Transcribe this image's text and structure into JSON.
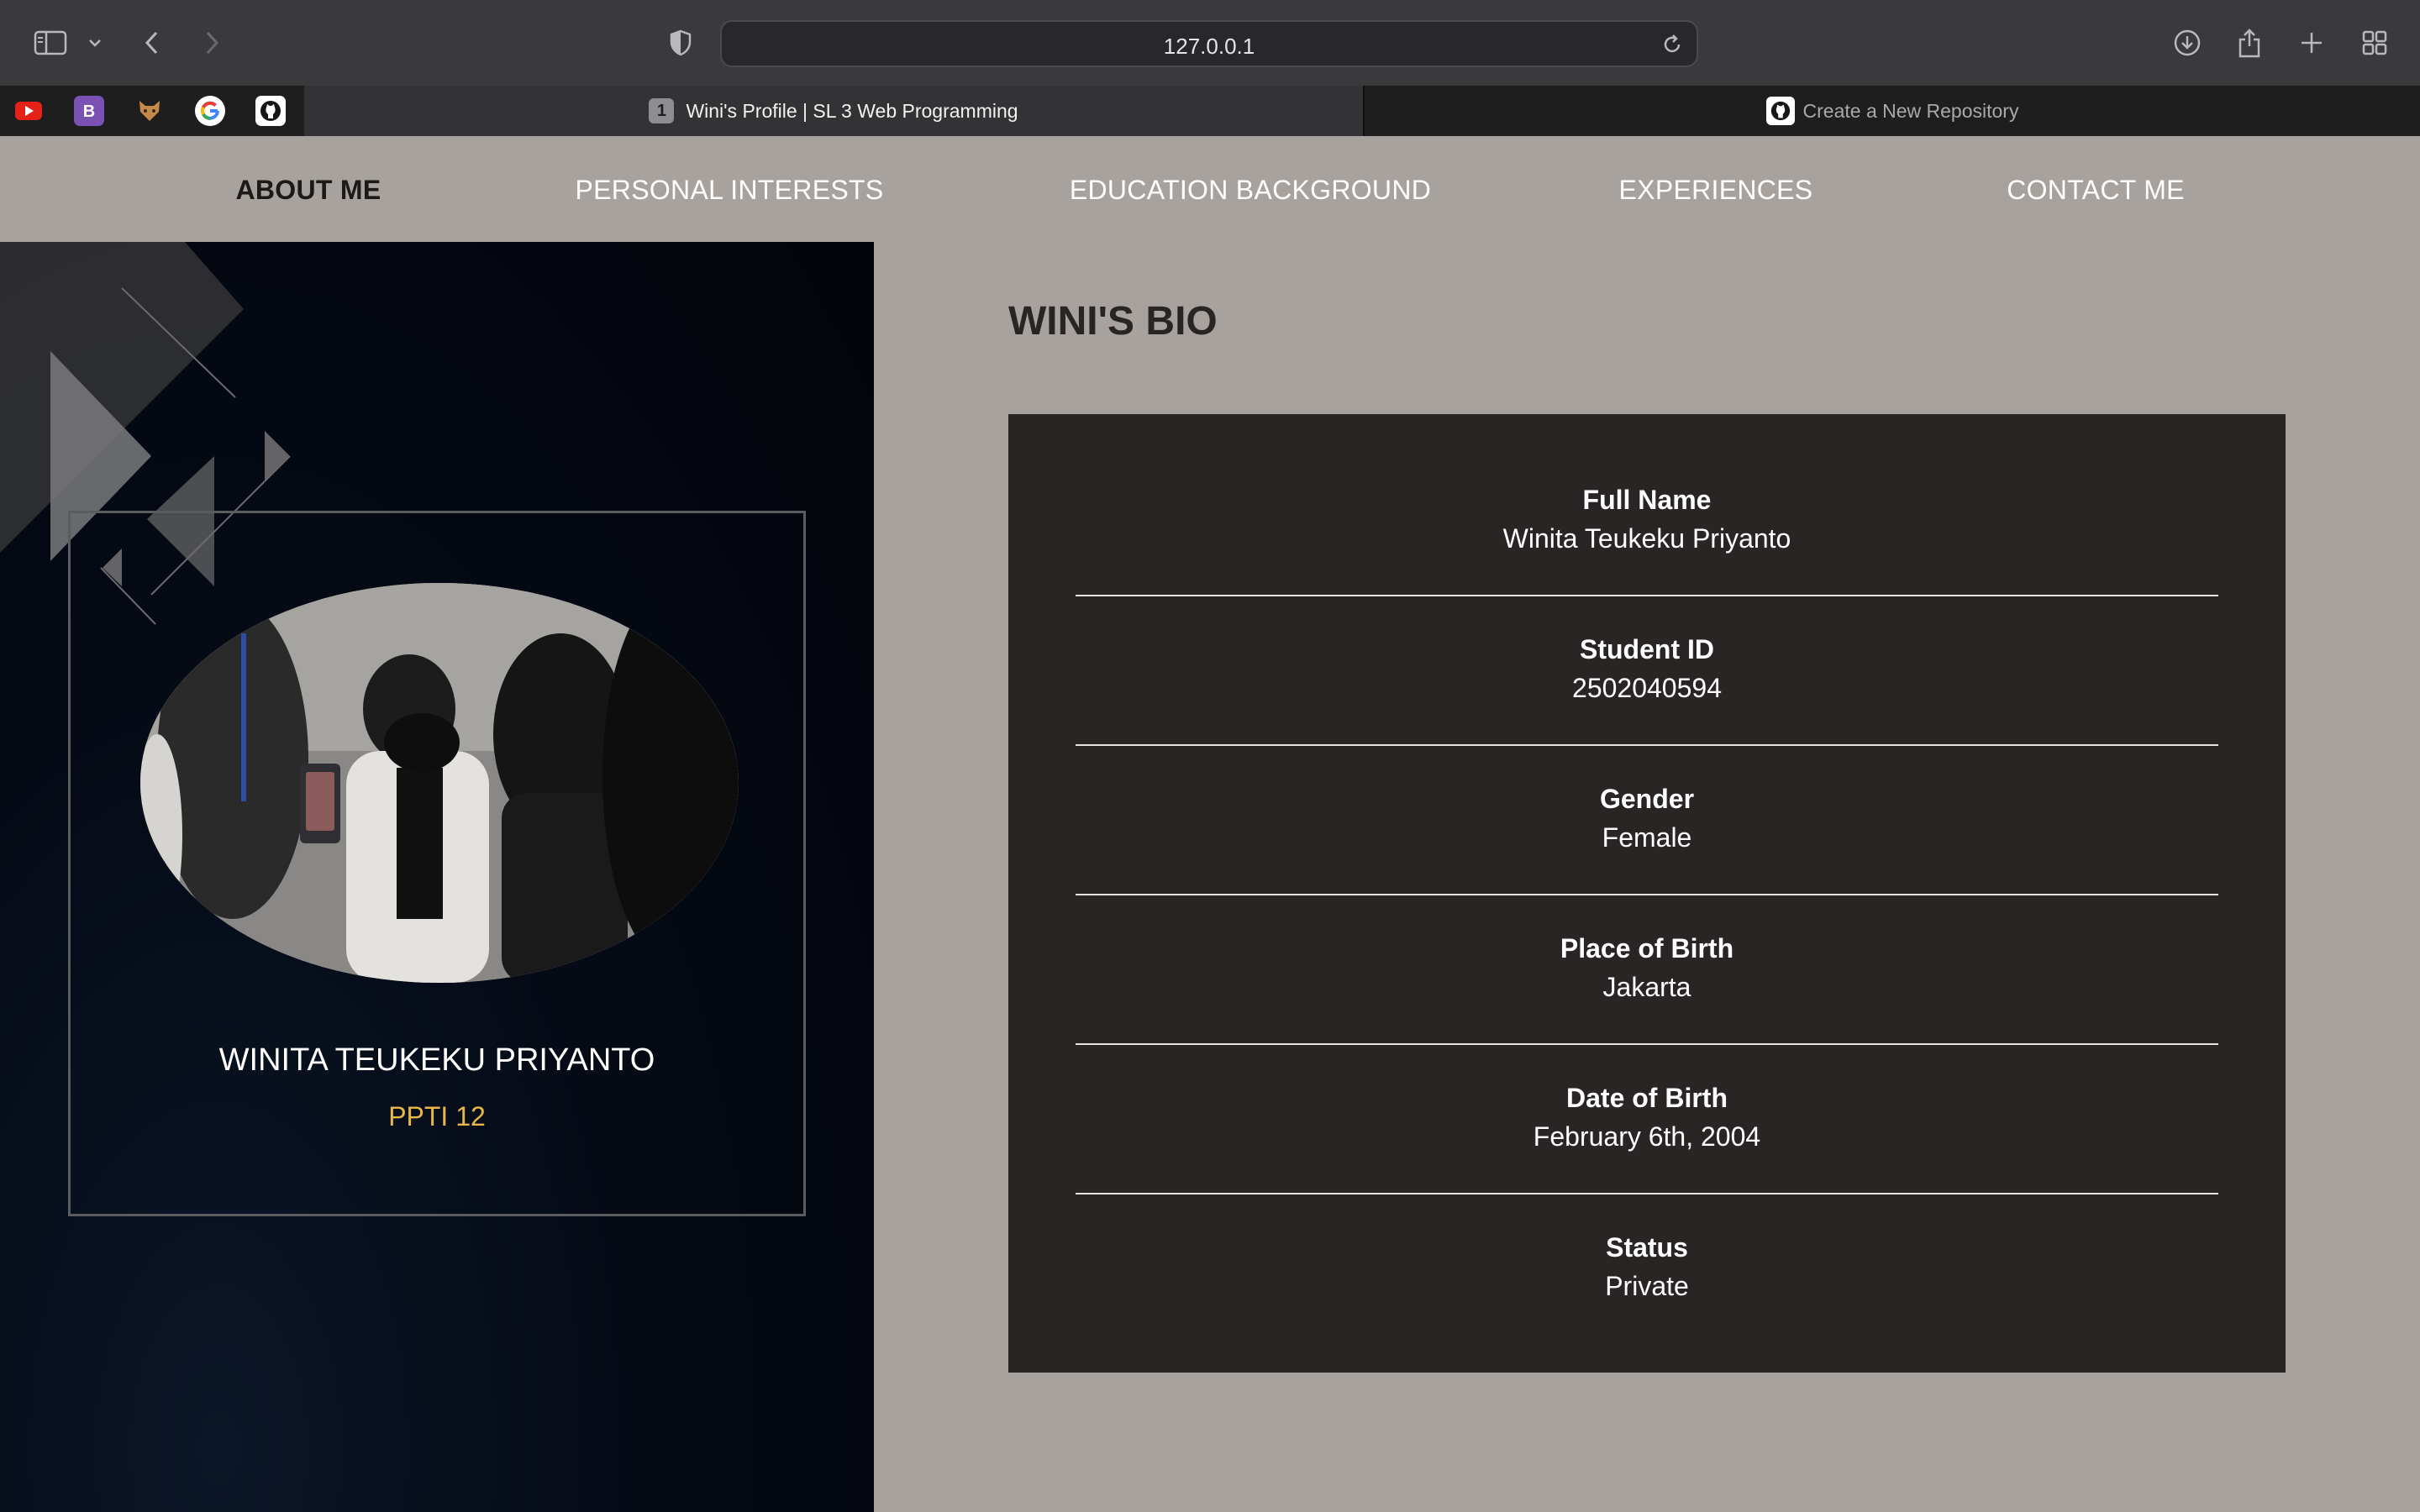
{
  "browser": {
    "url": "127.0.0.1",
    "tabs": [
      {
        "label": "Wini's Profile | SL 3 Web Programming",
        "badge": "1",
        "active": true
      },
      {
        "label": "Create a New Repository",
        "active": false
      }
    ],
    "favorites": [
      "youtube-icon",
      "bootstrap-icon",
      "animal-icon",
      "google-icon",
      "github-icon"
    ]
  },
  "nav": {
    "items": [
      "ABOUT ME",
      "PERSONAL INTERESTS",
      "EDUCATION BACKGROUND",
      "EXPERIENCES",
      "CONTACT ME"
    ],
    "active": "ABOUT ME"
  },
  "profile": {
    "name": "WINITA TEUKEKU PRIYANTO",
    "class": "PPTI 12"
  },
  "bio": {
    "title": "WINI'S BIO",
    "rows": [
      {
        "label": "Full Name",
        "value": "Winita Teukeku Priyanto"
      },
      {
        "label": "Student ID",
        "value": "2502040594"
      },
      {
        "label": "Gender",
        "value": "Female"
      },
      {
        "label": "Place of Birth",
        "value": "Jakarta"
      },
      {
        "label": "Date of Birth",
        "value": "February 6th, 2004"
      },
      {
        "label": "Status",
        "value": "Private"
      }
    ]
  },
  "colors": {
    "page_bg": "#a8a29e",
    "panel_dark": "#292524",
    "accent_gold": "#e8b64a"
  }
}
